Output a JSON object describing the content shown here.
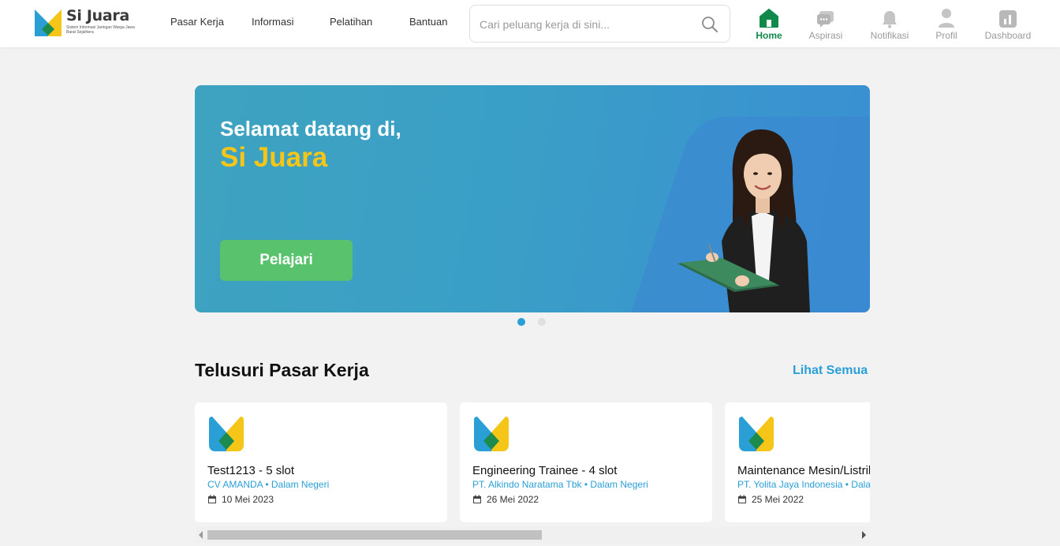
{
  "header": {
    "logo_title": "Si Juara",
    "logo_subtitle": "Sistem Informasi Jaringan Warga Jawa Barat Sejahtera",
    "nav": [
      "Pasar Kerja",
      "Informasi",
      "Pelatihan",
      "Bantuan"
    ],
    "search_placeholder": "Cari peluang kerja di sini...",
    "icons": [
      {
        "label": "Home",
        "icon": "home-icon",
        "active": true
      },
      {
        "label": "Aspirasi",
        "icon": "chat-icon",
        "active": false
      },
      {
        "label": "Notifikasi",
        "icon": "bell-icon",
        "active": false
      },
      {
        "label": "Profil",
        "icon": "user-icon",
        "active": false
      },
      {
        "label": "Dashboard",
        "icon": "chart-icon",
        "active": false
      }
    ],
    "active_color": "#11894a"
  },
  "banner": {
    "greeting": "Selamat datang di,",
    "title": "Si Juara",
    "button_label": "Pelajari",
    "slides_total": 2,
    "active_slide": 1
  },
  "section": {
    "title": "Telusuri Pasar Kerja",
    "see_all": "Lihat Semua"
  },
  "jobs": [
    {
      "title": "Test1213 - 5 slot",
      "meta": "CV AMANDA • Dalam Negeri",
      "date": "10 Mei 2023"
    },
    {
      "title": "Engineering Trainee - 4 slot",
      "meta": "PT. Alkindo Naratama Tbk • Dalam Negeri",
      "date": "26 Mei 2022"
    },
    {
      "title": "Maintenance Mesin/Listrik",
      "meta": "PT. Yolita Jaya Indonesia • Dalam Negeri",
      "date": "25 Mei 2022"
    }
  ],
  "colors": {
    "brand_blue": "#2a9fd6",
    "brand_yellow": "#f5c518",
    "button_green": "#58c26c"
  }
}
